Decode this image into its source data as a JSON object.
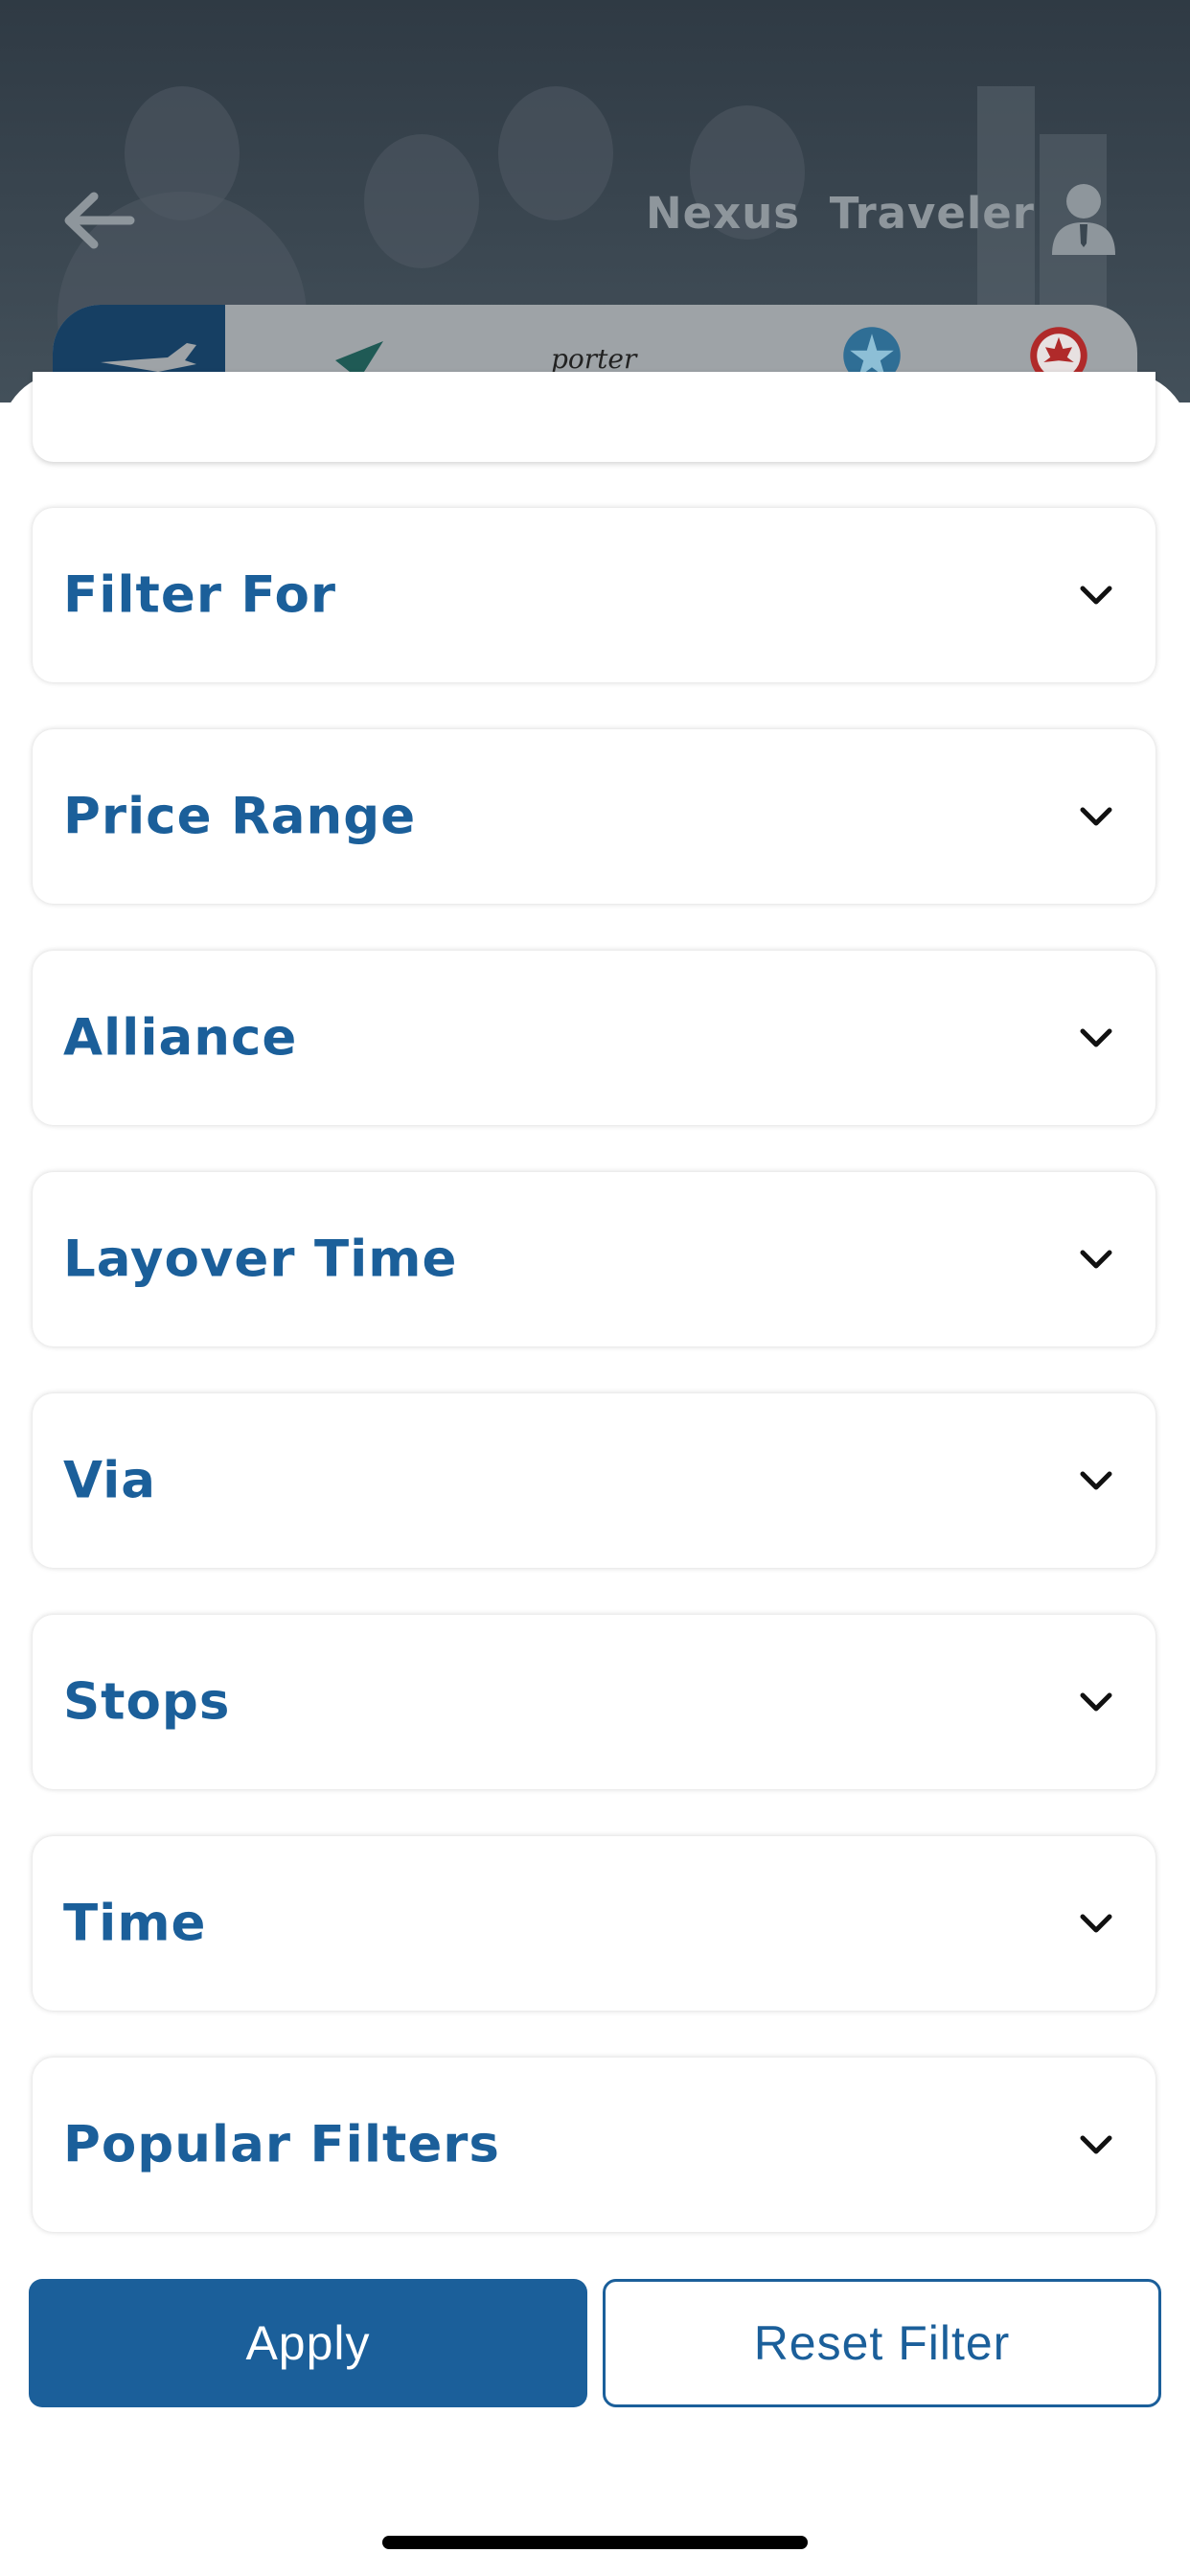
{
  "header": {
    "title_part1": "Nexus",
    "title_part2": "Traveler",
    "back_icon": "arrow-left-icon",
    "profile_icon": "user-icon"
  },
  "airline_strip": {
    "logos": [
      "plane-icon",
      "airline-logo",
      "porter-logo",
      "star-alliance-logo",
      "air-canada-logo"
    ],
    "porter_text": "porter"
  },
  "filters": [
    {
      "label": "Filter For"
    },
    {
      "label": "Price Range"
    },
    {
      "label": "Alliance"
    },
    {
      "label": "Layover Time"
    },
    {
      "label": "Via"
    },
    {
      "label": "Stops"
    },
    {
      "label": "Time"
    },
    {
      "label": "Popular Filters"
    }
  ],
  "actions": {
    "apply_label": "Apply",
    "reset_label": "Reset Filter"
  },
  "colors": {
    "primary": "#1b5f9a",
    "header_bg": "#3a4650",
    "title_text": "#8e969c"
  }
}
